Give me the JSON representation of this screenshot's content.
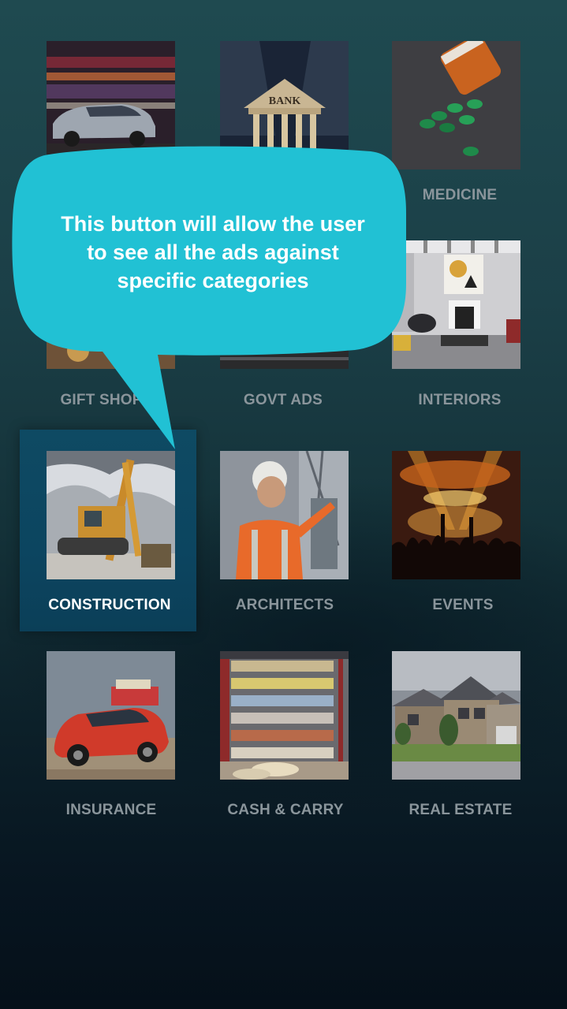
{
  "categories": [
    {
      "id": "automobiles",
      "label": ""
    },
    {
      "id": "banks",
      "label": ""
    },
    {
      "id": "medicine",
      "label": "MEDICINE"
    },
    {
      "id": "gift-shops",
      "label": "GIFT SHOPS"
    },
    {
      "id": "govt-ads",
      "label": "GOVT ADS"
    },
    {
      "id": "interiors",
      "label": "INTERIORS"
    },
    {
      "id": "construction",
      "label": "CONSTRUCTION"
    },
    {
      "id": "architects",
      "label": "ARCHITECTS"
    },
    {
      "id": "events",
      "label": "EVENTS"
    },
    {
      "id": "insurance",
      "label": "INSURANCE"
    },
    {
      "id": "cash-carry",
      "label": "CASH & CARRY"
    },
    {
      "id": "real-estate",
      "label": "REAL ESTATE"
    }
  ],
  "bank_sign": "BANK",
  "tooltip": {
    "line1": "This button will allow the user",
    "line2": "to see all the ads against",
    "line3": "specific categories"
  },
  "colors": {
    "bubble": "#21c1d4",
    "highlight": "#0e4a63",
    "label": "#8a959b",
    "label_active": "#ffffff"
  }
}
